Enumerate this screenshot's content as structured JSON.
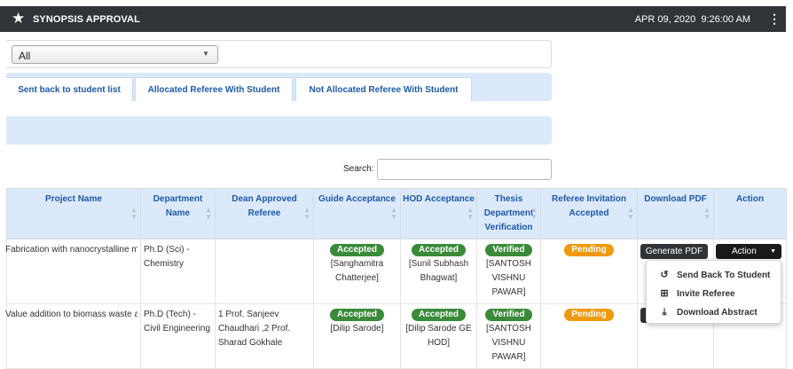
{
  "header": {
    "title": "SYNOPSIS APPROVAL",
    "date": "APR 09, 2020",
    "time": "9:26:00 AM",
    "star_icon": "star-icon",
    "menu_icon": "kebab-menu-icon"
  },
  "filter": {
    "selected": "All"
  },
  "tabs": [
    {
      "label": "Sent back to student list"
    },
    {
      "label": "Allocated Referee With Student"
    },
    {
      "label": "Not Allocated Referee With Student"
    }
  ],
  "search": {
    "label": "Search:",
    "value": ""
  },
  "table": {
    "columns": [
      "Project Name",
      "Department Name",
      "Dean Approved Referee",
      "Guide Acceptance",
      "HOD Acceptance",
      "Thesis Department Verification",
      "Referee Invitation Accepted",
      "Download PDF",
      "Action"
    ],
    "rows": [
      {
        "project": "Fabrication with nanocrystalline materials for electrochemical sensing of biological analytes.",
        "department": "Ph.D (Sci) - Chemistry",
        "referee": "",
        "guide_status": "Accepted",
        "guide_name": "[Sanghamitra Chatterjee]",
        "hod_status": "Accepted",
        "hod_name": "[Sunil Subhash Bhagwat]",
        "thesis_status": "Verified",
        "thesis_name": "[SANTOSH VISHNU PAWAR]",
        "referee_status": "Pending"
      },
      {
        "project": "Value addition to biomass waste as alternative fuel",
        "department": "Ph.D (Tech) - Civil Engineering",
        "referee": "1 Prof. Sanjeev Chaudhari ,2 Prof. Sharad Gokhale",
        "guide_status": "Accepted",
        "guide_name": "[Dilip Sarode]",
        "hod_status": "Accepted",
        "hod_name": "[Dilip Sarode GE HOD]",
        "thesis_status": "Verified",
        "thesis_name": "[SANTOSH VISHNU PAWAR]",
        "referee_status": "Pending"
      }
    ]
  },
  "buttons": {
    "generate_pdf": "Generate PDF",
    "action": "Action"
  },
  "action_menu": [
    {
      "label": "Send Back To Student",
      "icon": "undo-icon"
    },
    {
      "label": "Invite Referee",
      "icon": "plus-square-icon"
    },
    {
      "label": "Download Abstract",
      "icon": "download-icon"
    }
  ],
  "colors": {
    "header_bg": "#2f3438",
    "accent_blue": "#1d5aa8",
    "tab_bg": "#dbe9fa",
    "accepted": "#3a8a3a",
    "pending": "#f0990c"
  }
}
